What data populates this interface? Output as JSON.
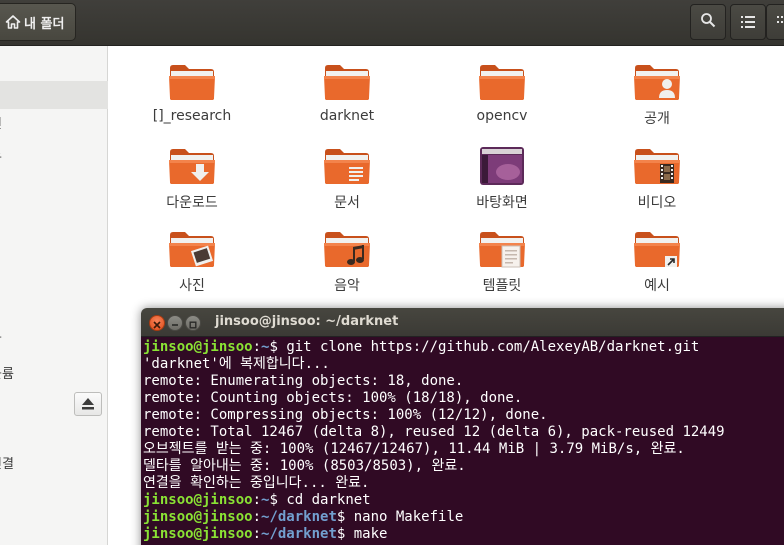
{
  "header": {
    "path_label": "내 폴더",
    "search_icon": "search-icon",
    "list_view_icon": "list-view-icon",
    "grid_view_icon": "grid-view-icon"
  },
  "sidebar": {
    "items": [
      {
        "label": "",
        "selected": true
      },
      {
        "label": "면"
      },
      {
        "label": "드"
      },
      {
        "label": "크"
      },
      {
        "label": "볼륨"
      },
      {
        "label": "연결"
      }
    ]
  },
  "files": [
    {
      "label": "[]_research",
      "icon": "folder-icon"
    },
    {
      "label": "darknet",
      "icon": "folder-icon"
    },
    {
      "label": "opencv",
      "icon": "folder-icon"
    },
    {
      "label": "공개",
      "icon": "folder-public-icon"
    },
    {
      "label": "다운로드",
      "icon": "folder-download-icon"
    },
    {
      "label": "문서",
      "icon": "folder-documents-icon"
    },
    {
      "label": "바탕화면",
      "icon": "folder-desktop-icon"
    },
    {
      "label": "비디오",
      "icon": "folder-videos-icon"
    },
    {
      "label": "사진",
      "icon": "folder-pictures-icon"
    },
    {
      "label": "음악",
      "icon": "folder-music-icon"
    },
    {
      "label": "템플릿",
      "icon": "folder-templates-icon"
    },
    {
      "label": "예시",
      "icon": "folder-link-icon"
    }
  ],
  "terminal": {
    "title": "jinsoo@jinsoo: ~/darknet",
    "prompt_user": "jinsoo@jinsoo",
    "lines": [
      {
        "type": "prompt",
        "path": "~",
        "cmd": "git clone https://github.com/AlexeyAB/darknet.git"
      },
      {
        "type": "out",
        "text": "'darknet'에 복제합니다..."
      },
      {
        "type": "out",
        "text": "remote: Enumerating objects: 18, done."
      },
      {
        "type": "out",
        "text": "remote: Counting objects: 100% (18/18), done."
      },
      {
        "type": "out",
        "text": "remote: Compressing objects: 100% (12/12), done."
      },
      {
        "type": "out",
        "text": "remote: Total 12467 (delta 8), reused 12 (delta 6), pack-reused 12449"
      },
      {
        "type": "out",
        "text": "오브젝트를 받는 중: 100% (12467/12467), 11.44 MiB | 3.79 MiB/s, 완료."
      },
      {
        "type": "out",
        "text": "델타를 알아내는 중: 100% (8503/8503), 완료."
      },
      {
        "type": "out",
        "text": "연결을 확인하는 중입니다... 완료."
      },
      {
        "type": "prompt",
        "path": "~",
        "cmd": "cd darknet"
      },
      {
        "type": "prompt",
        "path": "~/darknet",
        "cmd": "nano Makefile"
      },
      {
        "type": "prompt",
        "path": "~/darknet",
        "cmd": "make"
      }
    ]
  },
  "colors": {
    "folder": "#e9692c",
    "terminal_bg": "#300a24",
    "prompt_user": "#8ae234",
    "prompt_path": "#729fcf"
  }
}
